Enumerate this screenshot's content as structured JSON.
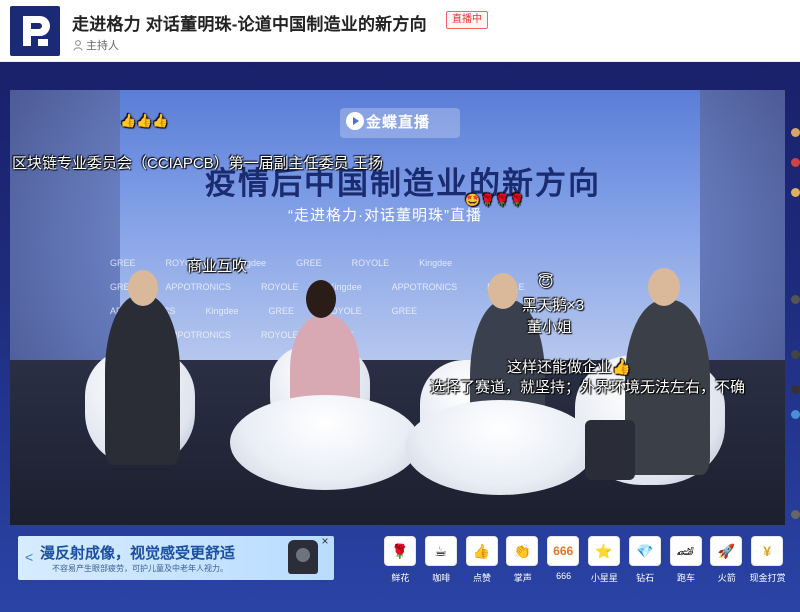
{
  "header": {
    "title": "走进格力 对话董明珠-论道中国制造业的新方向",
    "live_badge": "直播中",
    "host_label": "主持人"
  },
  "video": {
    "brand": "金蝶直播",
    "big_title": "疫情后中国制造业的新方向",
    "sub_title": "“走进格力·对话董明珠”直播",
    "sponsor_logos": [
      "GREE",
      "ROYOLE",
      "Kingdee",
      "APPOTRONICS"
    ]
  },
  "danmaku": {
    "thumbs": "👍👍👍",
    "speaker_caption": "区块链专业委员会（CCIAPCB）第一届副主任委员 王扬",
    "roses": "🤩🌹🌹🌹",
    "comment_1": "商业互吹",
    "smile": "😇",
    "comment_2": "黑天鹅×3",
    "comment_3": "董小姐",
    "comment_4": "这样还能做企业👍",
    "comment_5": "选择了赛道，就坚持；外界环境无法左右，不确"
  },
  "ad": {
    "arrow": "<",
    "title": "漫反射成像，视觉感受更舒适",
    "subtitle": "不容易产生眼部疲劳，可护儿童及中老年人视力。",
    "close": "×"
  },
  "gifts": [
    {
      "label": "鲜花",
      "icon": "🌹"
    },
    {
      "label": "咖啡",
      "icon": "☕"
    },
    {
      "label": "点赞",
      "icon": "👍"
    },
    {
      "label": "掌声",
      "icon": "👏"
    },
    {
      "label": "666",
      "icon": "666"
    },
    {
      "label": "小星星",
      "icon": "⭐"
    },
    {
      "label": "钻石",
      "icon": "💎"
    },
    {
      "label": "跑车",
      "icon": "🏎"
    },
    {
      "label": "火箭",
      "icon": "🚀"
    },
    {
      "label": "现金打赏",
      "icon": "¥"
    }
  ]
}
